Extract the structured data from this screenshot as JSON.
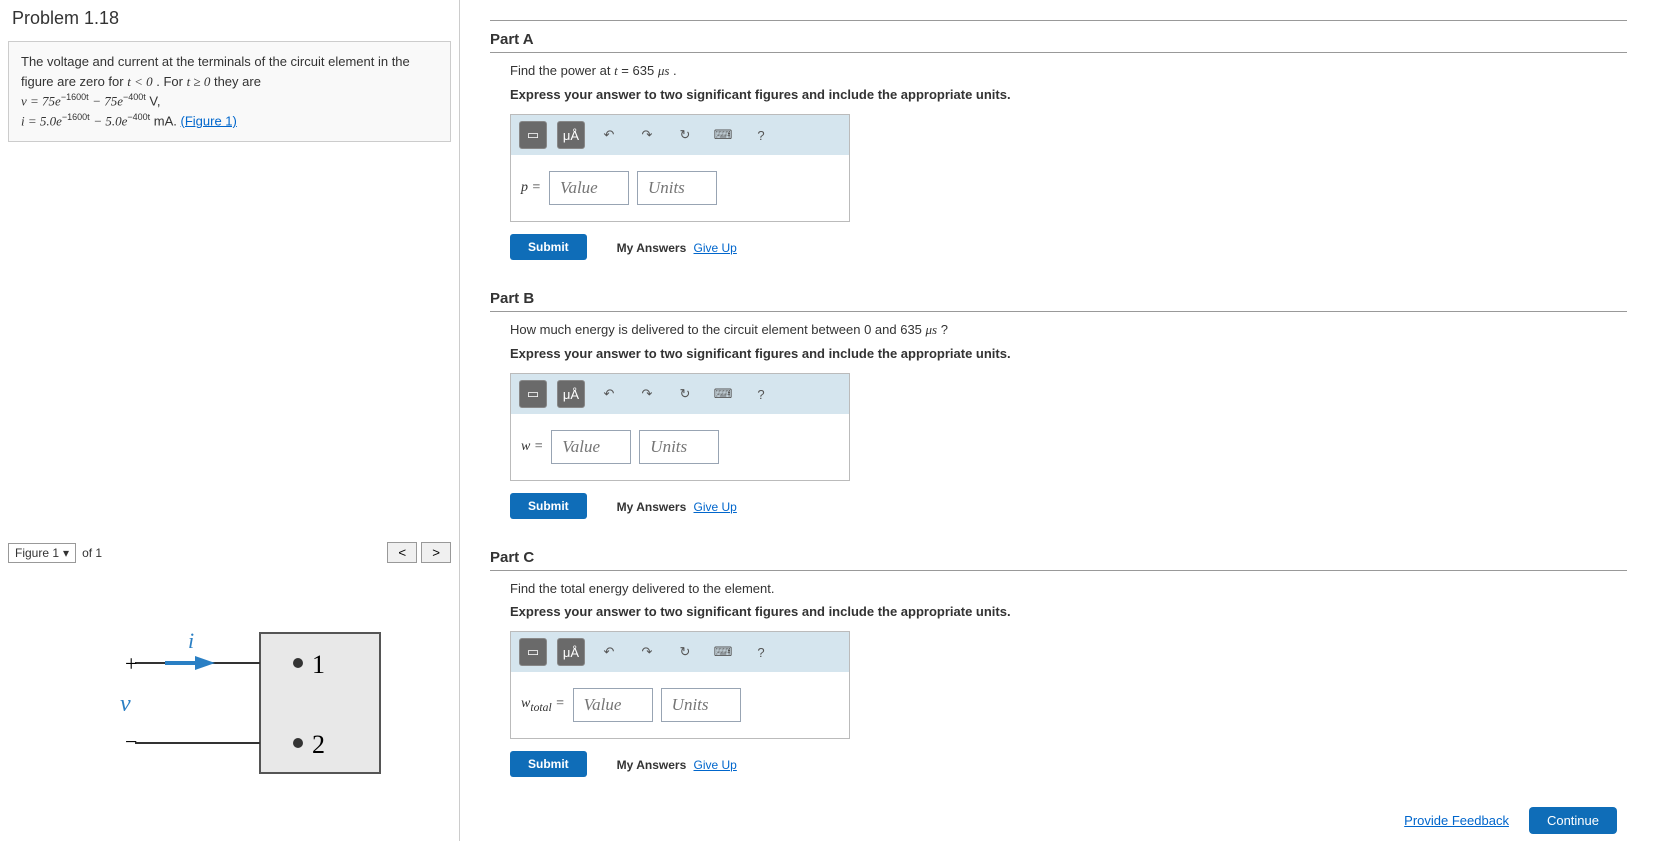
{
  "problem": {
    "title": "Problem 1.18",
    "description_line1": "The voltage and current at the terminals of the circuit element in the figure are zero for ",
    "cond1": "t < 0",
    "for_text": ". For ",
    "cond2": "t ≥ 0",
    "they_are": " they are",
    "v_eq": "v = 75e",
    "v_exp1": "−1600t",
    "v_minus": " − 75e",
    "v_exp2": "−400t",
    "v_unit": " V,",
    "i_eq": "i = 5.0e",
    "i_exp1": "−1600t",
    "i_minus": " − 5.0e",
    "i_exp2": "−400t",
    "i_unit": "mA",
    "figure_link": "(Figure 1)"
  },
  "figure": {
    "dropdown": "Figure 1",
    "of_text": "of 1",
    "labels": {
      "i": "i",
      "v": "v",
      "plus": "+",
      "minus": "−",
      "t1": "1",
      "t2": "2"
    }
  },
  "parts": {
    "a": {
      "title": "Part A",
      "question": "Find the power at t = 635 μs .",
      "instruction": "Express your answer to two significant figures and include the appropriate units.",
      "var": "p ="
    },
    "b": {
      "title": "Part B",
      "question": "How much energy is delivered to the circuit element between 0 and 635 μs ?",
      "instruction": "Express your answer to two significant figures and include the appropriate units.",
      "var": "w ="
    },
    "c": {
      "title": "Part C",
      "question": "Find the total energy delivered to the element.",
      "instruction": "Express your answer to two significant figures and include the appropriate units.",
      "var": "wₜₒₜₐₗ ="
    }
  },
  "common": {
    "value_placeholder": "Value",
    "units_placeholder": "Units",
    "submit": "Submit",
    "my_answers": "My Answers",
    "give_up": "Give Up",
    "feedback": "Provide Feedback",
    "continue": "Continue",
    "toolbar_special": "μÅ",
    "help": "?"
  }
}
